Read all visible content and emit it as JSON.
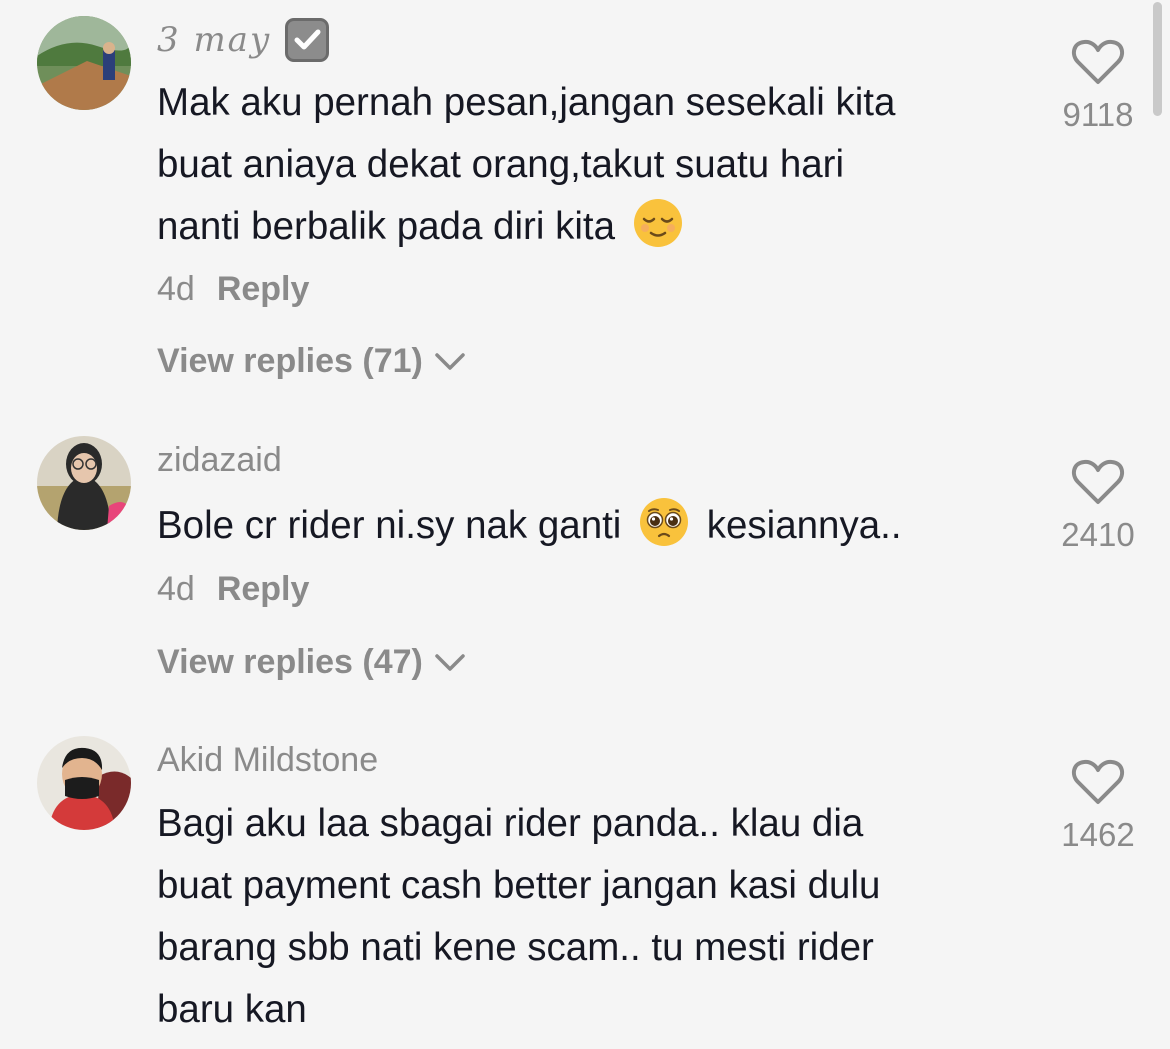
{
  "comments": [
    {
      "username": "3 may",
      "verified": true,
      "text_lines": [
        "Mak aku pernah pesan,jangan sesekali kita",
        "buat aniaya dekat orang,takut suatu hari",
        "nanti berbalik pada diri kita"
      ],
      "emoji": "relieved-face",
      "time": "4d",
      "reply_label": "Reply",
      "view_replies": "View replies (71)",
      "likes": "9118"
    },
    {
      "username": "zidazaid",
      "text_before_emoji": "Bole cr rider ni.sy nak ganti",
      "emoji": "pleading-face",
      "text_after_emoji": "kesiannya..",
      "time": "4d",
      "reply_label": "Reply",
      "view_replies": "View replies (47)",
      "likes": "2410"
    },
    {
      "username": "Akid Mildstone",
      "text_lines": [
        "Bagi aku laa sbagai rider panda.. klau dia",
        "buat payment cash better jangan kasi dulu",
        "barang sbb nati kene scam.. tu mesti rider",
        "baru kan"
      ],
      "likes": "1462"
    }
  ],
  "colors": {
    "background": "#f5f5f5",
    "primary_text": "#161823",
    "secondary_text": "#8a8a8a"
  }
}
